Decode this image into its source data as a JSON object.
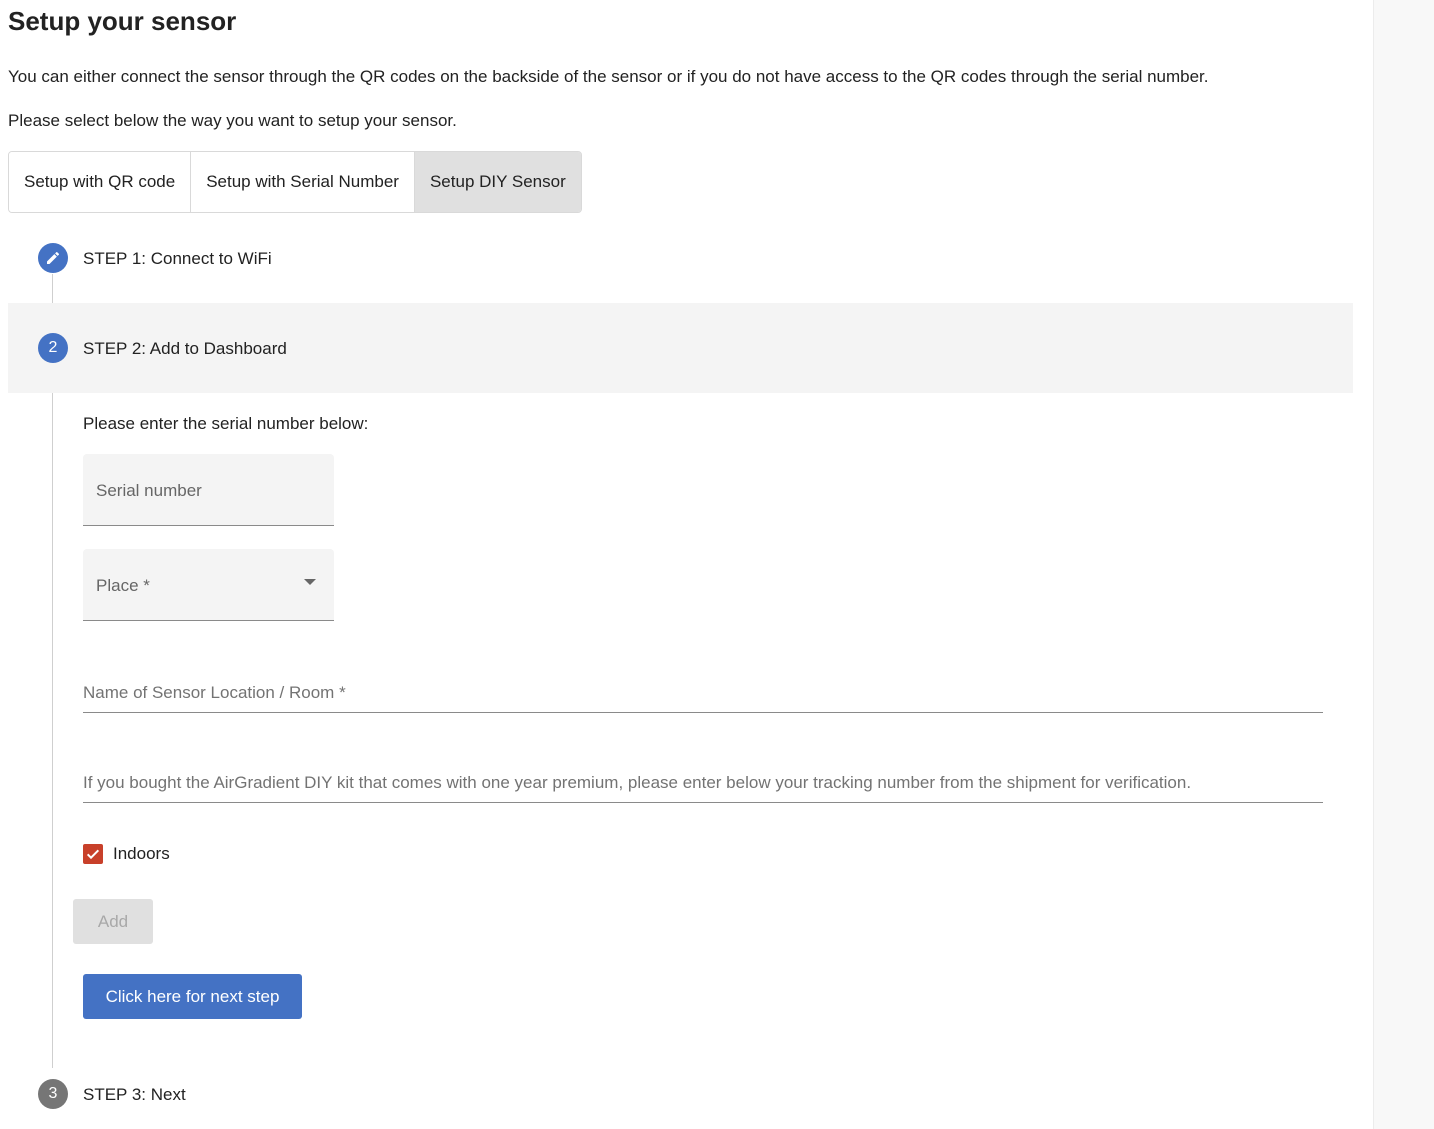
{
  "page": {
    "title": "Setup your sensor",
    "intro": "You can either connect the sensor through the QR codes on the backside of the sensor or if you do not have access to the QR codes through the serial number.",
    "select_prompt": "Please select below the way you want to setup your sensor."
  },
  "tabs": [
    {
      "label": "Setup with QR code",
      "active": false
    },
    {
      "label": "Setup with Serial Number",
      "active": false
    },
    {
      "label": "Setup DIY Sensor",
      "active": true
    }
  ],
  "steps": [
    {
      "number": "",
      "icon": "pencil-icon",
      "label": "STEP 1: Connect to WiFi",
      "state": "completed"
    },
    {
      "number": "2",
      "label": "STEP 2: Add to Dashboard",
      "state": "active"
    },
    {
      "number": "3",
      "label": "STEP 3: Next",
      "state": "pending"
    }
  ],
  "form": {
    "prompt": "Please enter the serial number below:",
    "serial_placeholder": "Serial number",
    "place_placeholder": "Place *",
    "location_placeholder": "Name of Sensor Location / Room *",
    "tracking_placeholder": "If you bought the AirGradient DIY kit that comes with one year premium, please enter below your tracking number from the shipment for verification.",
    "indoors_label": "Indoors",
    "indoors_checked": true,
    "add_label": "Add",
    "next_label": "Click here for next step"
  },
  "colors": {
    "primary": "#4472c4",
    "checkbox": "#c8402a",
    "step_pending": "#767676",
    "active_step_bg": "#f4f4f4"
  }
}
